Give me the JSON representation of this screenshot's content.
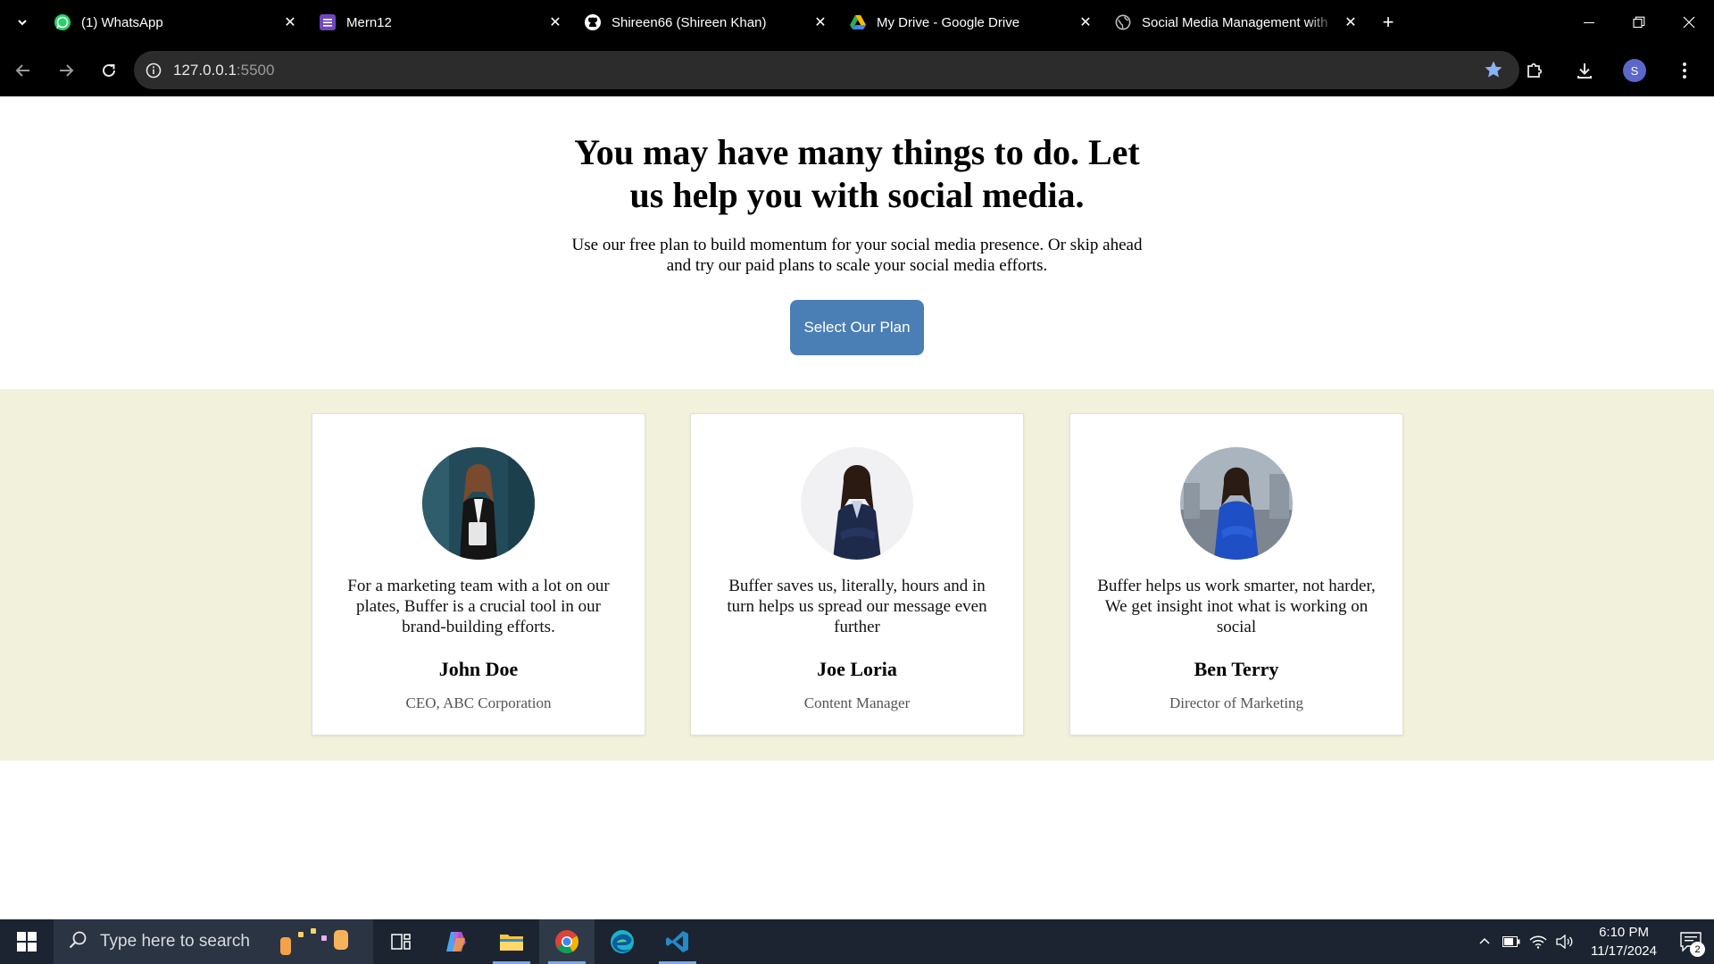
{
  "browser": {
    "tabs": [
      {
        "title": "(1) WhatsApp",
        "icon": "whatsapp-icon"
      },
      {
        "title": "Mern12",
        "icon": "forms-icon"
      },
      {
        "title": "Shireen66 (Shireen Khan)",
        "icon": "github-icon"
      },
      {
        "title": "My Drive - Google Drive",
        "icon": "google-drive-icon"
      },
      {
        "title": "Social Media Management with",
        "icon": "globe-icon",
        "active": true
      }
    ],
    "url_host": "127.0.0.1",
    "url_port": ":5500",
    "profile_initial": "S",
    "accent": "#5b67c9"
  },
  "hero": {
    "title": "You may have many things to do. Let us help you with social media.",
    "subtitle": "Use our free plan to build momentum for your social media presence. Or skip ahead and try our paid plans to scale your social media efforts.",
    "cta_label": "Select Our Plan",
    "cta_color": "#4a7fb5"
  },
  "testimonials": {
    "background": "#f2f2dc",
    "cards": [
      {
        "quote": "For a marketing team with a lot on our plates, Buffer is a crucial tool in our brand-building efforts.",
        "name": "John Doe",
        "role": "CEO, ABC Corporation"
      },
      {
        "quote": "Buffer saves us, literally, hours and in turn helps us spread our message even further",
        "name": "Joe Loria",
        "role": "Content Manager"
      },
      {
        "quote": "Buffer helps us work smarter, not harder, We get insight inot what is working on social",
        "name": "Ben Terry",
        "role": "Director of Marketing"
      }
    ]
  },
  "taskbar": {
    "search_placeholder": "Type here to search",
    "apps": [
      "task-view-icon",
      "copilot-icon",
      "file-explorer-icon",
      "chrome-icon",
      "edge-icon",
      "vscode-icon"
    ],
    "time": "6:10 PM",
    "date": "11/17/2024",
    "notification_count": "2"
  }
}
